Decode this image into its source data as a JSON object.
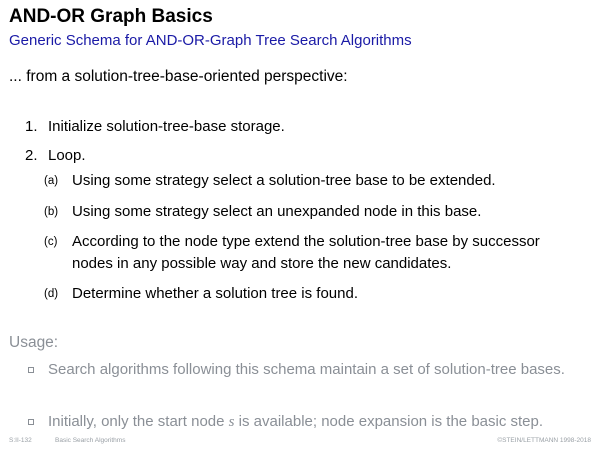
{
  "header": {
    "title": "AND-OR Graph Basics",
    "subtitle": "Generic Schema for AND-OR-Graph Tree Search Algorithms"
  },
  "intro": "... from a solution-tree-base-oriented perspective:",
  "steps": [
    {
      "number": "1.",
      "text": "Initialize solution-tree-base storage."
    },
    {
      "number": "2.",
      "text": "Loop."
    }
  ],
  "substeps": [
    {
      "label": "(a)",
      "text": "Using some strategy select a solution-tree base to be extended."
    },
    {
      "label": "(b)",
      "text": "Using some strategy select an unexpanded node in this base."
    },
    {
      "label": "(c)",
      "text": "According to the node type extend the solution-tree base by successor nodes in any possible way and store the new candidates."
    },
    {
      "label": "(d)",
      "text": "Determine whether a solution tree is found."
    }
  ],
  "usage": {
    "heading": "Usage:",
    "bullets": [
      {
        "text": "Search algorithms following this schema maintain a set of solution-tree bases."
      },
      {
        "before": "Initially, only the start node ",
        "var": "s",
        "after": " is available; node expansion is the basic step."
      }
    ]
  },
  "footer": {
    "slide_id": "S:II-132",
    "topic": "Basic Search Algorithms",
    "copyright": "©STEIN/LETTMANN 1998-2018"
  },
  "colors": {
    "subtitle": "#1a1aa6",
    "usage_gray": "#8a8f96"
  }
}
